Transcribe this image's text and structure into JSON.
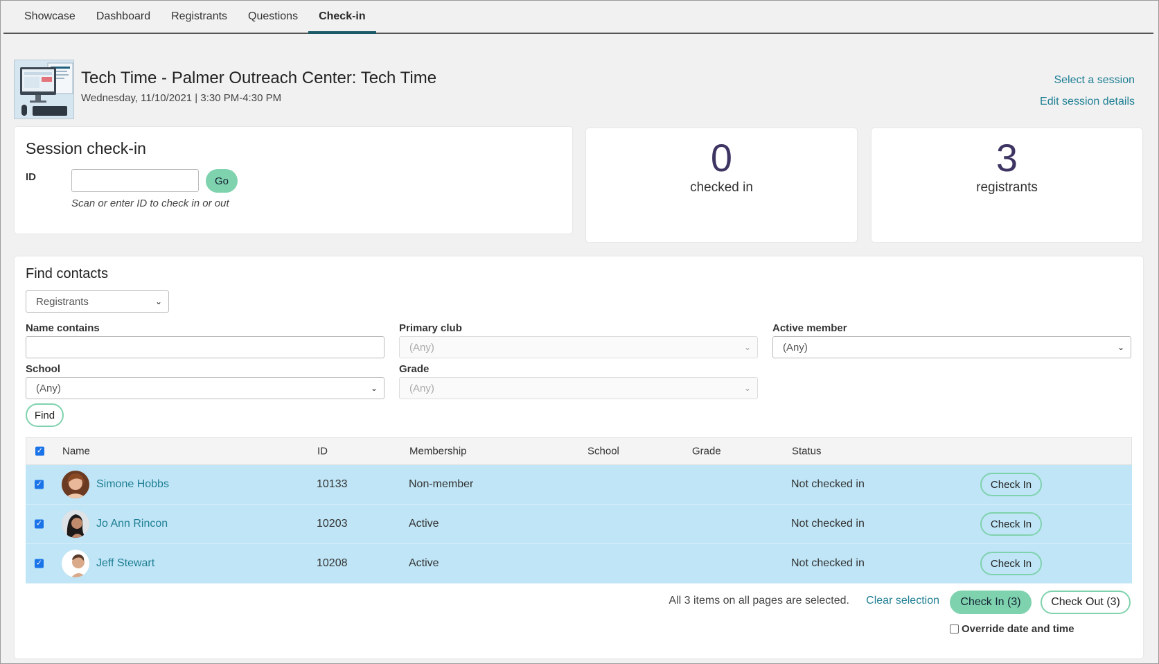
{
  "tabs": [
    {
      "label": "Showcase"
    },
    {
      "label": "Dashboard"
    },
    {
      "label": "Registrants"
    },
    {
      "label": "Questions"
    },
    {
      "label": "Check-in",
      "active": true
    }
  ],
  "header": {
    "title": "Tech Time - Palmer Outreach Center: Tech Time",
    "date": "Wednesday, 11/10/2021 | 3:30 PM-4:30 PM",
    "select_session": "Select a session",
    "edit_session": "Edit session details"
  },
  "checkin": {
    "heading": "Session check-in",
    "id_label": "ID",
    "go_label": "Go",
    "hint": "Scan or enter ID to check in or out"
  },
  "stats": {
    "checked_in_value": "0",
    "checked_in_label": "checked in",
    "registrants_value": "3",
    "registrants_label": "registrants"
  },
  "find": {
    "heading": "Find contacts",
    "list_select": "Registrants",
    "name_label": "Name contains",
    "primary_club_label": "Primary club",
    "primary_club_value": "(Any)",
    "active_member_label": "Active member",
    "active_member_value": "(Any)",
    "school_label": "School",
    "school_value": "(Any)",
    "grade_label": "Grade",
    "grade_value": "(Any)",
    "find_button": "Find"
  },
  "table": {
    "columns": {
      "name": "Name",
      "id": "ID",
      "membership": "Membership",
      "school": "School",
      "grade": "Grade",
      "status": "Status"
    },
    "rows": [
      {
        "name": "Simone Hobbs",
        "id": "10133",
        "membership": "Non-member",
        "school": "",
        "grade": "",
        "status": "Not checked in",
        "action": "Check In"
      },
      {
        "name": "Jo Ann Rincon",
        "id": "10203",
        "membership": "Active",
        "school": "",
        "grade": "",
        "status": "Not checked in",
        "action": "Check In"
      },
      {
        "name": "Jeff Stewart",
        "id": "10208",
        "membership": "Active",
        "school": "",
        "grade": "",
        "status": "Not checked in",
        "action": "Check In"
      }
    ]
  },
  "footer": {
    "selection_text": "All 3 items on all pages are selected.",
    "clear_selection": "Clear selection",
    "bulk_check_in": "Check In (3)",
    "bulk_check_out": "Check Out (3)",
    "override_label": "Override date and time"
  },
  "colors": {
    "accent": "#7fd2ae",
    "link": "#1f7f94",
    "stat_number": "#3e3563",
    "selected_row": "#bfe5f6"
  }
}
